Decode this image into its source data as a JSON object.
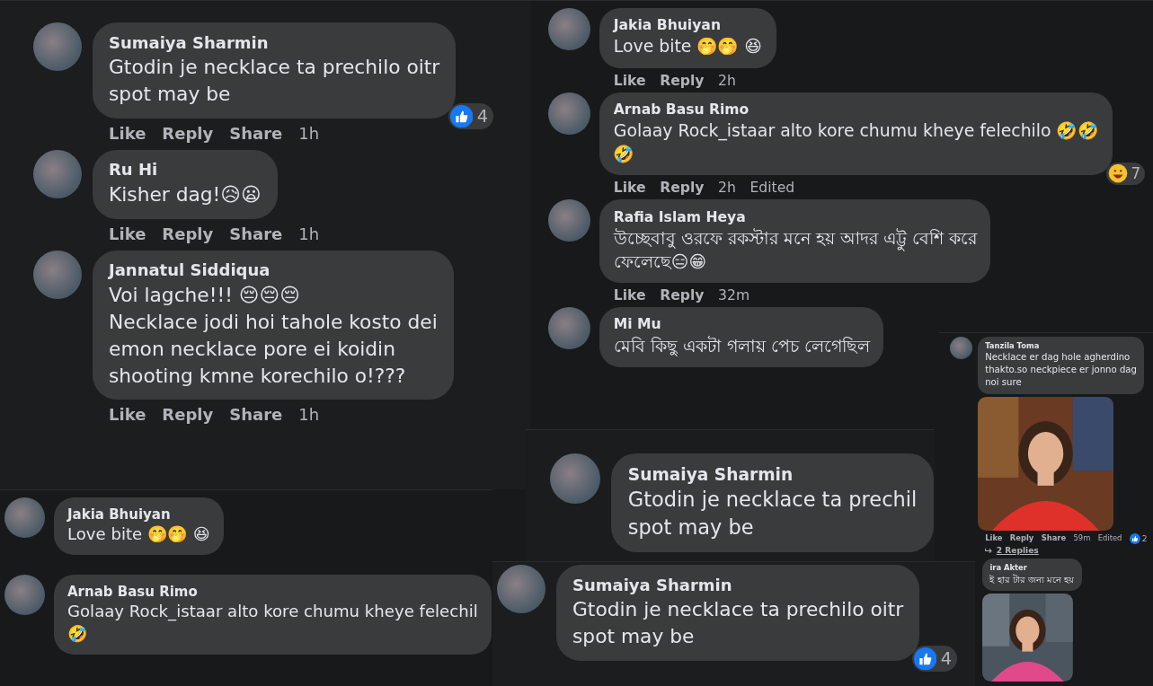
{
  "panels": [
    {
      "comments": [
        {
          "author": "Sumaiya Sharmin",
          "lines": [
            "Gtodin je necklace ta prechilo oitr",
            "spot may be"
          ],
          "reaction": {
            "kind": "like",
            "count": "4"
          },
          "actions": [
            {
              "label": "Like",
              "kind": "action"
            },
            {
              "label": "Reply",
              "kind": "action"
            },
            {
              "label": "Share",
              "kind": "action"
            },
            {
              "label": "1h",
              "kind": "time"
            }
          ]
        },
        {
          "author": "Ru Hi",
          "lines": [
            "Kisher dag!😥😦"
          ],
          "actions": [
            {
              "label": "Like",
              "kind": "action"
            },
            {
              "label": "Reply",
              "kind": "action"
            },
            {
              "label": "Share",
              "kind": "action"
            },
            {
              "label": "1h",
              "kind": "time"
            }
          ]
        },
        {
          "author": "Jannatul Siddiqua",
          "lines": [
            "Voi lagche!!! 😔😔😔",
            "Necklace jodi hoi tahole kosto dei",
            "emon necklace pore ei koidin",
            "shooting kmne korechilo o!???"
          ],
          "actions": [
            {
              "label": "Like",
              "kind": "action"
            },
            {
              "label": "Reply",
              "kind": "action"
            },
            {
              "label": "Share",
              "kind": "action"
            },
            {
              "label": "1h",
              "kind": "time"
            }
          ]
        }
      ]
    },
    {
      "comments": [
        {
          "author": "Jakia Bhuiyan",
          "lines": [
            "Love bite 🤭🤭 😆"
          ],
          "actions": [
            {
              "label": "Like",
              "kind": "action"
            },
            {
              "label": "Reply",
              "kind": "action"
            },
            {
              "label": "2h",
              "kind": "time"
            }
          ]
        },
        {
          "author": "Arnab Basu Rimo",
          "lines": [
            "Golaay Rock_istaar alto kore chumu kheye felechilo 🤣🤣",
            "🤣"
          ],
          "reaction": {
            "kind": "haha",
            "count": "7"
          },
          "actions": [
            {
              "label": "Like",
              "kind": "action"
            },
            {
              "label": "Reply",
              "kind": "action"
            },
            {
              "label": "2h",
              "kind": "time"
            },
            {
              "label": "Edited",
              "kind": "note"
            }
          ]
        },
        {
          "author": "Rafia Islam Heya",
          "lines": [
            "উচ্ছেবাবু ওরফে রকস্টার মনে হয় আদর এট্টু বেশি করে",
            "ফেলেছে😑😁"
          ],
          "actions": [
            {
              "label": "Like",
              "kind": "action"
            },
            {
              "label": "Reply",
              "kind": "action"
            },
            {
              "label": "32m",
              "kind": "time"
            }
          ]
        },
        {
          "author": "Mi Mu",
          "lines": [
            "মেবি কিছু একটা গলায় পেচ লেগেছিল"
          ]
        }
      ]
    },
    {
      "comments": [
        {
          "author": "Jakia Bhuiyan",
          "lines": [
            "Love bite 🤭🤭 😆"
          ]
        },
        {
          "author": "Arnab Basu Rimo",
          "lines": [
            "Golaay Rock_istaar alto kore chumu kheye felechil",
            "🤣"
          ]
        }
      ]
    },
    {
      "comments": [
        {
          "author": "Tanzila Toma",
          "lines": [
            "Necklace er dag hole agherdino",
            "thakto.so neckpiece er jonno dag",
            "noi sure"
          ],
          "attachment": {
            "kind": "picture"
          },
          "reaction": {
            "kind": "like",
            "count": "2"
          },
          "actions": [
            {
              "label": "Like",
              "kind": "action"
            },
            {
              "label": "Reply",
              "kind": "action"
            },
            {
              "label": "Share",
              "kind": "action"
            },
            {
              "label": "59m",
              "kind": "time"
            },
            {
              "label": "Edited",
              "kind": "note"
            }
          ],
          "replies": "2 Replies"
        },
        {
          "author": "ira Akter",
          "lines": [
            "ই হার টার জন্য মনে হয়"
          ],
          "attachment": {
            "kind": "picture"
          }
        }
      ]
    },
    {
      "comments": [
        {
          "author": "Sumaiya Sharmin",
          "lines": [
            "Gtodin je necklace ta prechil",
            "spot may be"
          ]
        }
      ]
    },
    {
      "comments": [
        {
          "author": "Sumaiya Sharmin",
          "lines": [
            "Gtodin je necklace ta prechilo oitr",
            "spot may be"
          ],
          "reaction": {
            "kind": "like",
            "count": "4"
          }
        }
      ]
    }
  ]
}
